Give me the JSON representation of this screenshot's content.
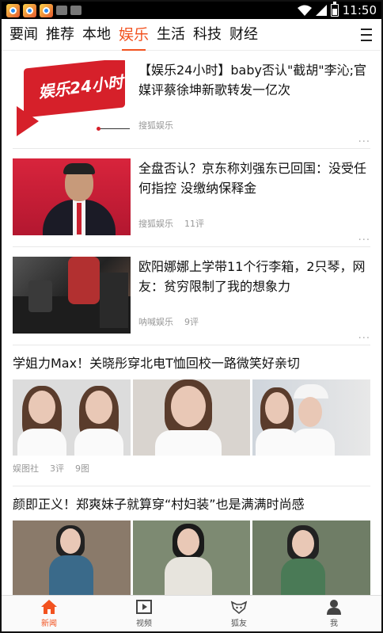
{
  "status_bar": {
    "time": "11:50"
  },
  "tabs": [
    "要闻",
    "推荐",
    "本地",
    "娱乐",
    "生活",
    "科技",
    "财经"
  ],
  "active_tab": "娱乐",
  "feed": [
    {
      "title": "【娱乐24小时】baby否认\"截胡\"李沁;官媒评蔡徐坤新歌转发一亿次",
      "source": "搜狐娱乐",
      "comments": "",
      "thumb_text": "娱乐24小时"
    },
    {
      "title": "全盘否认？京东称刘强东已回国：没受任何指控 没缴纳保释金",
      "source": "搜狐娱乐",
      "comments": "11评"
    },
    {
      "title": "欧阳娜娜上学带11个行李箱，2只琴，网友：贫穷限制了我的想象力",
      "source": "呐喊娱乐",
      "comments": "9评"
    },
    {
      "title": "学姐力Max！关晓彤穿北电T恤回校一路微笑好亲切",
      "source": "娱图社",
      "comments": "3评",
      "images": "9图"
    },
    {
      "title": "颜即正义！郑爽妹子就算穿“村妇装”也是满满时尚感"
    }
  ],
  "more_label": "...",
  "bottom_nav": [
    {
      "label": "新闻",
      "icon": "home-icon",
      "active": true
    },
    {
      "label": "视频",
      "icon": "video-icon",
      "active": false
    },
    {
      "label": "狐友",
      "icon": "fox-icon",
      "active": false
    },
    {
      "label": "我",
      "icon": "profile-icon",
      "active": false
    }
  ],
  "colors": {
    "accent": "#f2521f"
  }
}
